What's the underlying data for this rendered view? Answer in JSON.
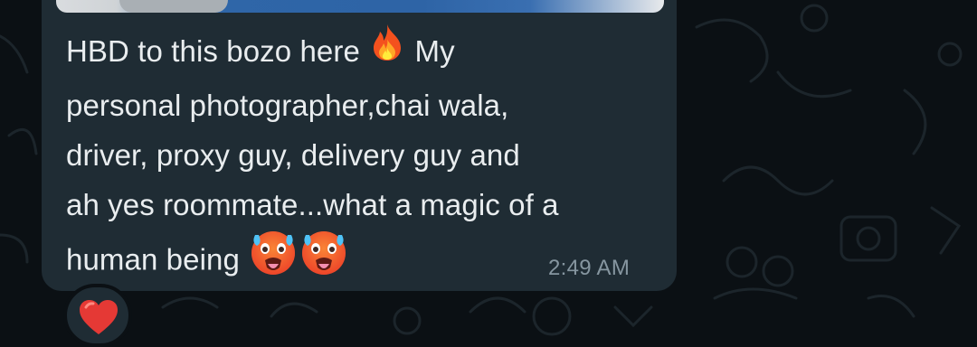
{
  "chat": {
    "message": {
      "lines": [
        "HBD to this bozo here",
        "My",
        "personal photographer,chai wala,",
        "driver, proxy guy, delivery guy and",
        "ah yes roommate...what a magic of a",
        "human being"
      ],
      "emojis": [
        "fire-emoji",
        "hot-face-emoji",
        "hot-face-emoji"
      ],
      "time": "2:49 AM"
    },
    "reaction": {
      "emoji": "red-heart-emoji"
    }
  },
  "colors": {
    "background": "#0b1014",
    "bubble": "#1f2c34",
    "text": "#e9edef",
    "timestamp": "#8696a0"
  }
}
